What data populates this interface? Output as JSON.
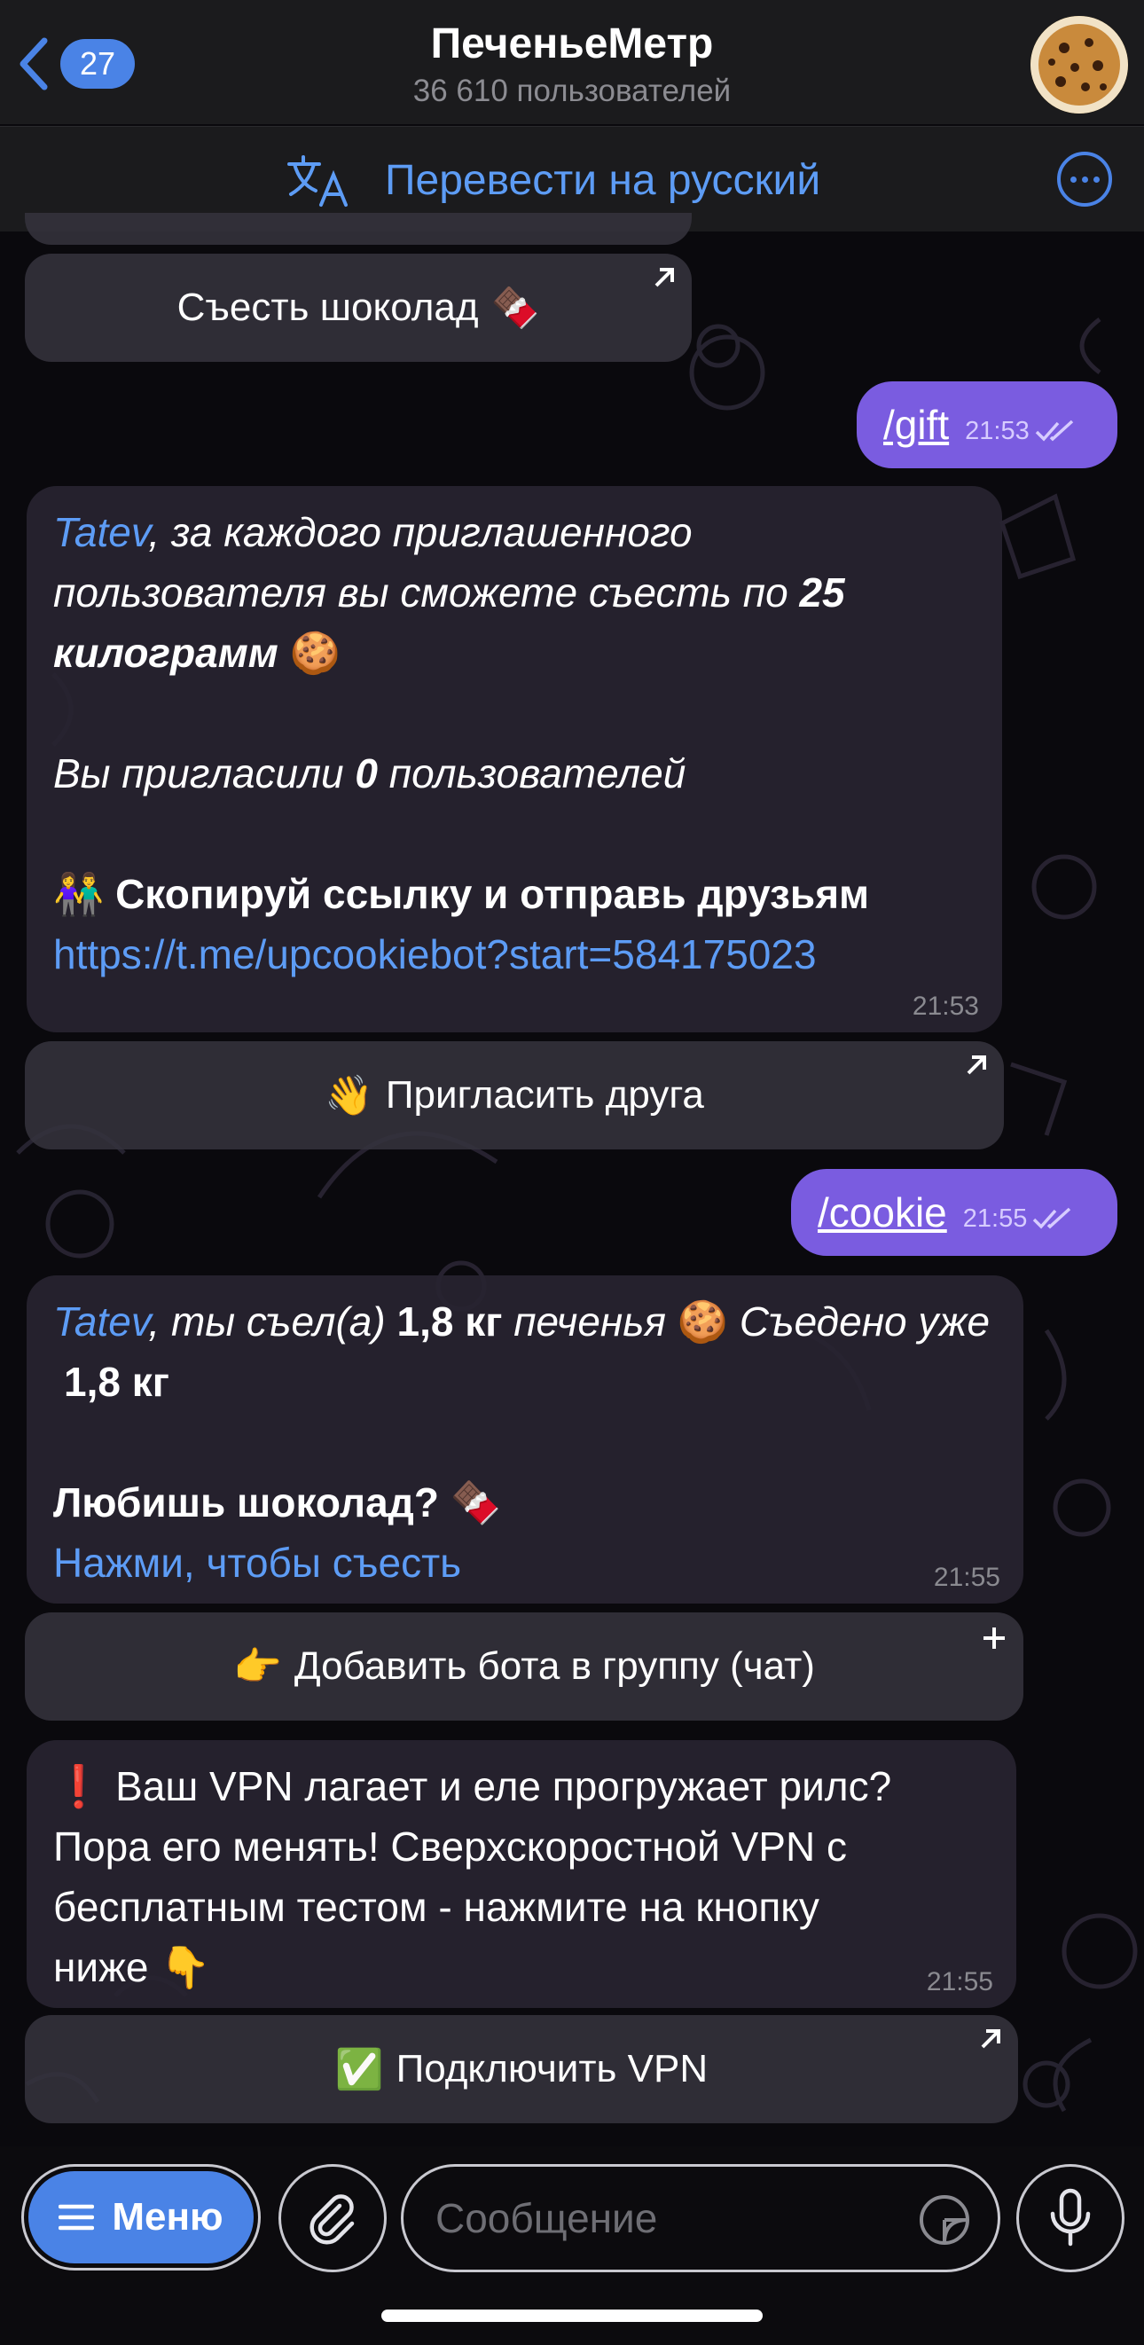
{
  "header": {
    "back_count": "27",
    "title": "ПеченьеМетр",
    "subtitle": "36 610 пользователей",
    "translate_label": "Перевести на русский"
  },
  "messages": {
    "kb_chocolate": "Съесть шоколад",
    "out_gift": "/gift",
    "out_gift_time": "21:53",
    "msg1": {
      "name": "Tatev",
      "part1": ", за каждого приглашенного пользователя вы сможете съесть по ",
      "amount": "25 килограмм",
      "invited_pre": "Вы пригласили ",
      "invited_count": "0",
      "invited_post": " пользователей",
      "copy_label": "Скопируй ссылку и отправь друзьям",
      "link": "https://t.me/upcookiebot?start=584175023",
      "time": "21:53"
    },
    "kb_invite": "Пригласить друга",
    "out_cookie": "/cookie",
    "out_cookie_time": "21:55",
    "msg2": {
      "name": "Tatev",
      "part1": ", ты съел(а) ",
      "eaten": "1,8 кг",
      "part2": " печенья ",
      "part3": " Съедено уже ",
      "total": "1,8 кг",
      "choc_question": "Любишь шоколад?",
      "tap_link": "Нажми, чтобы съесть",
      "time": "21:55"
    },
    "kb_add_bot": "Добавить бота в группу (чат)",
    "msg3": {
      "text1": "Ваш VPN лагает и еле прогружает рилс?",
      "text2": "Пора его менять! Сверхскоростной VPN с",
      "text3": "бесплатным тестом - нажмите на кнопку",
      "text4": "ниже",
      "time": "21:55"
    },
    "kb_vpn": "Подключить VPN"
  },
  "composer": {
    "menu_label": "Меню",
    "placeholder": "Сообщение"
  },
  "icons": {
    "back": "chevron-left-icon",
    "translate": "translate-icon",
    "more": "more-icon",
    "attach": "paperclip-icon",
    "sticker": "sticker-icon",
    "mic": "microphone-icon"
  },
  "colors": {
    "accent": "#4a83e6",
    "outgoing_bubble": "#7a5ce0",
    "link": "#5d9cf5"
  }
}
